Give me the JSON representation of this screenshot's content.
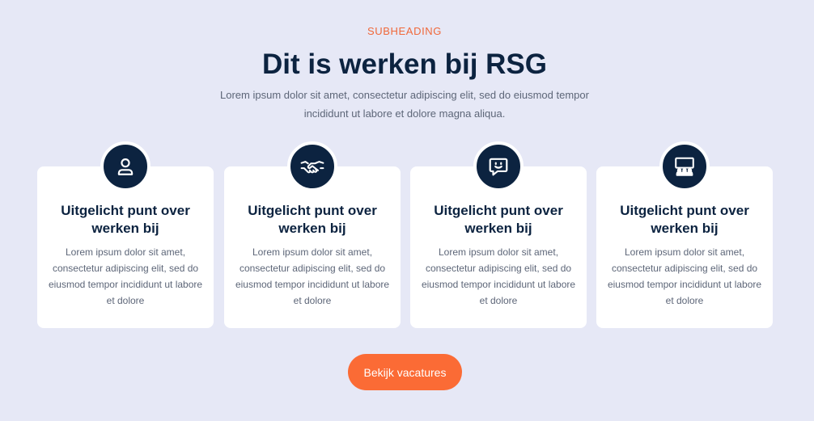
{
  "header": {
    "subheading": "SUBHEADING",
    "title": "Dit is werken bij RSG",
    "intro": "Lorem ipsum dolor sit amet, consectetur adipiscing elit, sed do eiusmod tempor incididunt ut labore et dolore magna aliqua."
  },
  "cards": [
    {
      "icon": "person-icon",
      "title": "Uitgelicht punt over werken bij",
      "text": "Lorem ipsum dolor sit amet, consectetur adipiscing elit, sed do eiusmod tempor incididunt ut labore et dolore"
    },
    {
      "icon": "handshake-icon",
      "title": "Uitgelicht punt over werken bij",
      "text": "Lorem ipsum dolor sit amet, consectetur adipiscing elit, sed do eiusmod tempor incididunt ut labore et dolore"
    },
    {
      "icon": "smiley-chat-icon",
      "title": "Uitgelicht punt over werken bij",
      "text": "Lorem ipsum dolor sit amet, consectetur adipiscing elit, sed do eiusmod tempor incididunt ut labore et dolore"
    },
    {
      "icon": "presentation-audience-icon",
      "title": "Uitgelicht punt over werken bij",
      "text": "Lorem ipsum dolor sit amet, consectetur adipiscing elit, sed do eiusmod tempor incididunt ut labore et dolore"
    }
  ],
  "cta": {
    "label": "Bekijk vacatures"
  },
  "colors": {
    "background": "#e6e8f6",
    "navy": "#0c2340",
    "accent": "#fb6b35",
    "subheading": "#f0683a",
    "body_text": "#5d6678",
    "card": "#ffffff"
  }
}
